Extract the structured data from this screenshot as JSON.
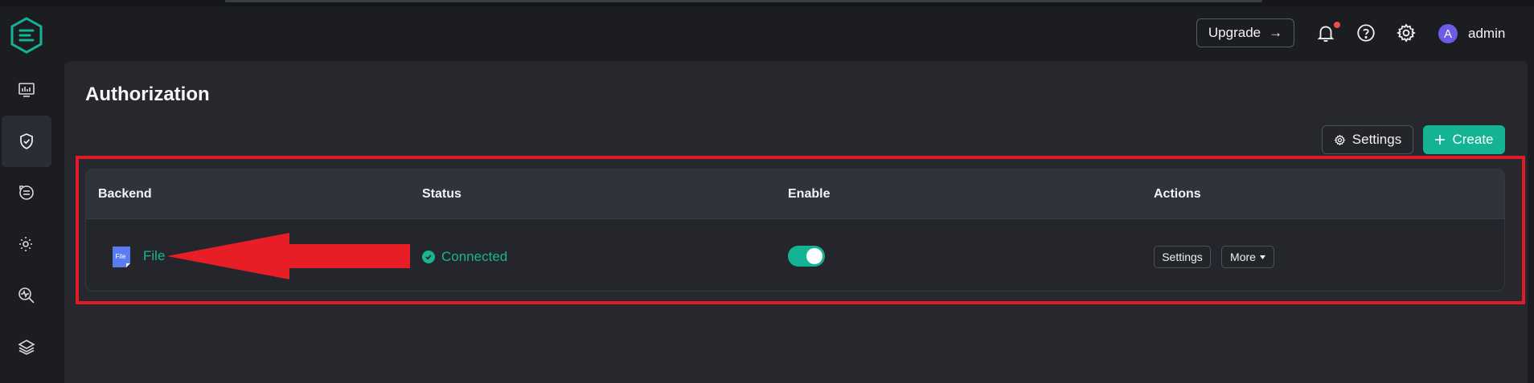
{
  "app": {
    "brand_color": "#14b394"
  },
  "header": {
    "upgrade_label": "Upgrade",
    "upgrade_arrow": "→",
    "avatar_letter": "A",
    "username": "admin",
    "icons": [
      "bell-icon",
      "help-icon",
      "gear-icon"
    ]
  },
  "sidebar": {
    "items": [
      {
        "name": "dashboard",
        "icon": "monitor-chart-icon",
        "active": false
      },
      {
        "name": "access-control",
        "icon": "shield-check-icon",
        "active": true
      },
      {
        "name": "integration",
        "icon": "data-flow-icon",
        "active": false
      },
      {
        "name": "management",
        "icon": "gear-plug-icon",
        "active": false
      },
      {
        "name": "diagnose",
        "icon": "search-pulse-icon",
        "active": false
      },
      {
        "name": "extensions",
        "icon": "layers-icon",
        "active": false
      }
    ]
  },
  "page": {
    "title": "Authorization",
    "settings_label": "Settings",
    "create_label": "Create"
  },
  "table": {
    "columns": [
      "Backend",
      "Status",
      "Enable",
      "Actions"
    ],
    "rows": [
      {
        "backend": "File",
        "backend_icon_text": "File",
        "status": "Connected",
        "enabled": true,
        "action_settings": "Settings",
        "action_more": "More"
      }
    ]
  },
  "annotation": {
    "color": "#e01b27"
  }
}
